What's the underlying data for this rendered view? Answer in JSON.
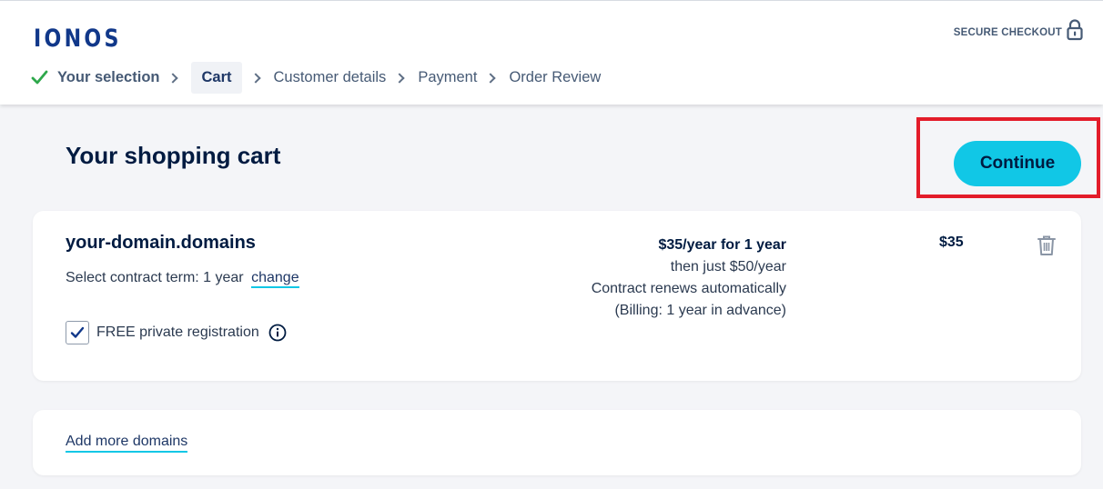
{
  "header": {
    "logo": "IONOS",
    "secure_label": "SECURE CHECKOUT",
    "icons": {
      "secure": "lock-icon",
      "done": "check-icon"
    }
  },
  "steps": [
    {
      "label": "Your selection",
      "state": "done"
    },
    {
      "label": "Cart",
      "state": "active"
    },
    {
      "label": "Customer details",
      "state": "upcoming"
    },
    {
      "label": "Payment",
      "state": "upcoming"
    },
    {
      "label": "Order Review",
      "state": "upcoming"
    }
  ],
  "main": {
    "title": "Your shopping cart",
    "continue_label": "Continue"
  },
  "item": {
    "domain": "your-domain.domains",
    "term_prefix": "Select contract term: 1 year",
    "change_label": "change",
    "privacy_label": "FREE private registration",
    "privacy_checked": true,
    "price_line1": "$35/year for 1 year",
    "price_line2": "then just $50/year",
    "price_line3": "Contract renews automatically",
    "price_line4": "(Billing: 1 year in advance)",
    "total": "$35",
    "icons": {
      "delete": "trash-icon",
      "info": "info-icon",
      "checkbox": "check-icon"
    }
  },
  "more": {
    "add_label": "Add more domains"
  },
  "colors": {
    "brand": "#11388a",
    "accent": "#11c7e6",
    "highlight": "#e31c2a",
    "done_check": "#2ea84b"
  }
}
